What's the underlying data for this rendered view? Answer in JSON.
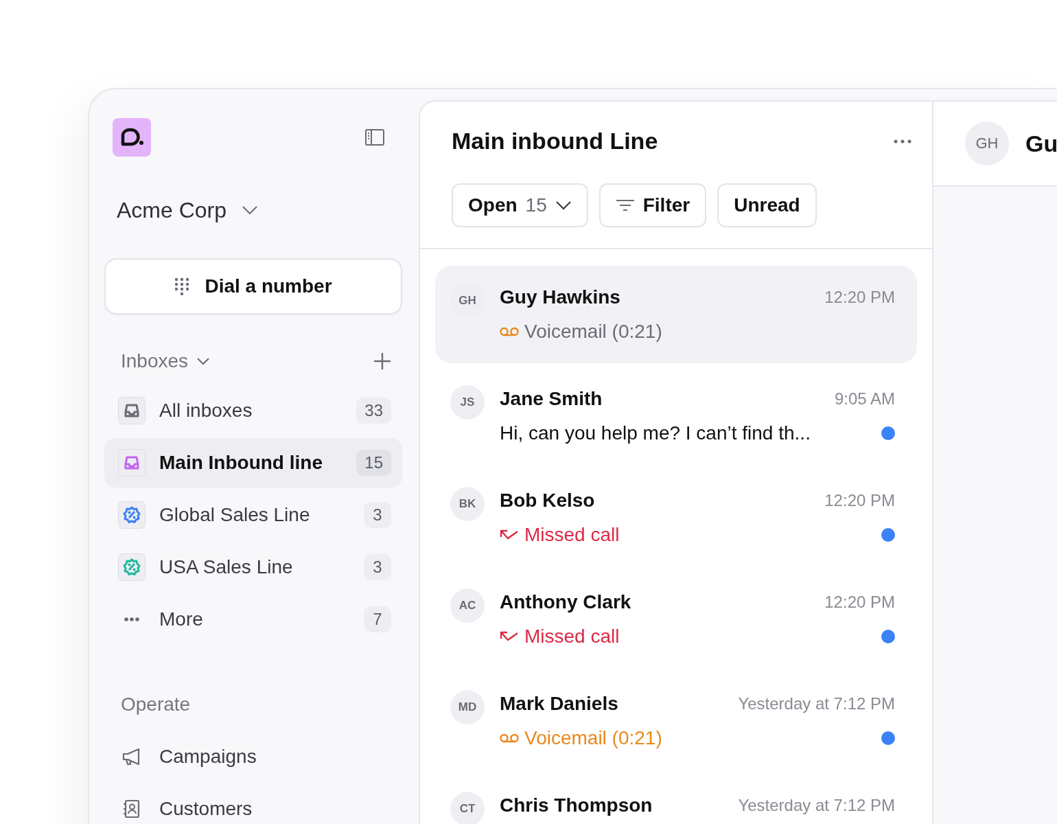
{
  "sidebar": {
    "workspace": "Acme Corp",
    "dial_button": "Dial a number",
    "inboxes_header": "Inboxes",
    "inboxes": [
      {
        "label": "All inboxes",
        "count": "33",
        "kind": "inbox",
        "color": "#6b6b75",
        "selected": false
      },
      {
        "label": "Main Inbound line",
        "count": "15",
        "kind": "inbox",
        "color": "#c365f0",
        "selected": true
      },
      {
        "label": "Global Sales Line",
        "count": "3",
        "kind": "badge",
        "color": "#3b82f6",
        "selected": false
      },
      {
        "label": "USA Sales Line",
        "count": "3",
        "kind": "badge",
        "color": "#1fb8a0",
        "selected": false
      },
      {
        "label": "More",
        "count": "7",
        "kind": "more",
        "color": "#6b6b75",
        "selected": false
      }
    ],
    "operate_header": "Operate",
    "operate_items": [
      {
        "label": "Campaigns",
        "kind": "megaphone"
      },
      {
        "label": "Customers",
        "kind": "contacts"
      }
    ]
  },
  "inbox": {
    "title": "Main inbound Line",
    "filters": [
      {
        "label": "Open",
        "count": "15",
        "kind": "dropdown"
      },
      {
        "label": "Filter",
        "kind": "filter"
      },
      {
        "label": "Unread",
        "kind": "plain"
      }
    ],
    "conversations": [
      {
        "initials": "GH",
        "name": "Guy Hawkins",
        "time": "12:20 PM",
        "kind": "voicemail",
        "preview": "Voicemail (0:21)",
        "unread": false,
        "selected": true
      },
      {
        "initials": "JS",
        "name": "Jane Smith",
        "time": "9:05 AM",
        "kind": "message",
        "preview": "Hi, can you help me? I can’t find th...",
        "unread": true,
        "selected": false
      },
      {
        "initials": "BK",
        "name": "Bob Kelso",
        "time": "12:20 PM",
        "kind": "missed",
        "preview": "Missed call",
        "unread": true,
        "selected": false
      },
      {
        "initials": "AC",
        "name": "Anthony Clark",
        "time": "12:20 PM",
        "kind": "missed",
        "preview": "Missed call",
        "unread": true,
        "selected": false
      },
      {
        "initials": "MD",
        "name": "Mark Daniels",
        "time": "Yesterday at 7:12 PM",
        "kind": "voicemail",
        "preview": "Voicemail (0:21)",
        "unread": true,
        "selected": false
      },
      {
        "initials": "CT",
        "name": "Chris Thompson",
        "time": "Yesterday at 7:12 PM",
        "selected": false
      }
    ]
  },
  "detail": {
    "initials": "GH",
    "name": "Gu"
  }
}
